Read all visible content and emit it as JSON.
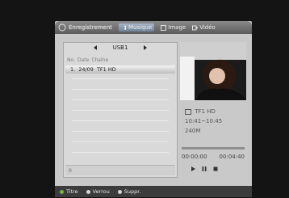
{
  "topbar": {
    "recorded_label": "Enregistrement",
    "tabs": [
      {
        "label": "Musique",
        "icon": "music-note-icon",
        "active": true
      },
      {
        "label": "Image",
        "icon": "image-icon",
        "active": false
      },
      {
        "label": "Vidéo",
        "icon": "video-icon",
        "active": false
      }
    ]
  },
  "browser": {
    "nav": {
      "left_icon": "arrow-left-icon",
      "title": "USB1",
      "right_icon": "arrow-right-icon"
    },
    "columns": [
      "No.",
      "Date",
      "Chaîne"
    ],
    "rows": [
      {
        "no": "1.",
        "date": "24/09",
        "channel": "TF1 HD"
      }
    ],
    "footer_value": "0"
  },
  "details": {
    "channel_name": "TF1 HD",
    "time_range": "10:41~10:45",
    "size": "240M",
    "progress": 0.0,
    "time_current": "00:00:00",
    "time_total": "00:04:40",
    "controls": [
      "play-icon",
      "pause-icon",
      "stop-icon"
    ]
  },
  "legend": [
    {
      "label": "Titre",
      "color": "#7cb342"
    },
    {
      "label": "Verrou",
      "color": "#d8d8d8"
    },
    {
      "label": "Suppr.",
      "color": "#d8d8d8"
    }
  ]
}
